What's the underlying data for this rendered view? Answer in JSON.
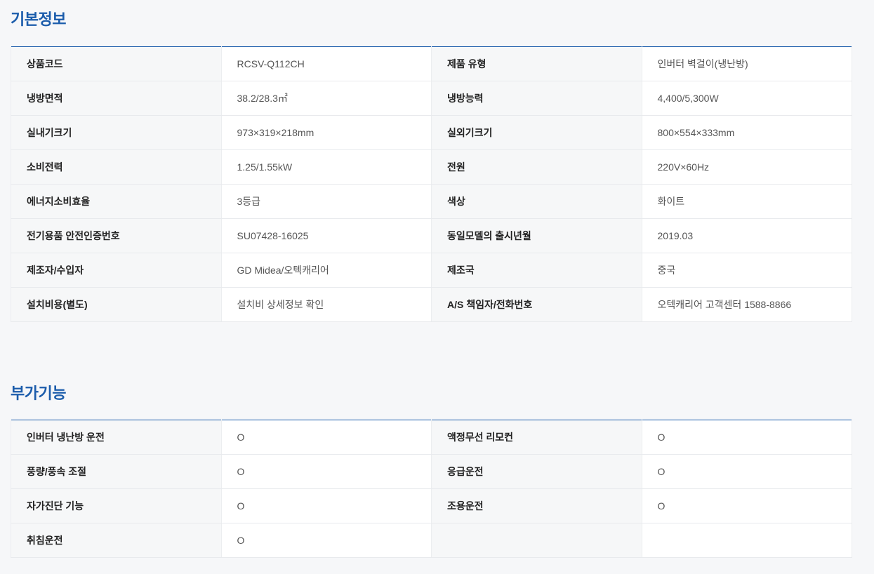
{
  "basic": {
    "title": "기본정보",
    "rows": [
      [
        {
          "label": "상품코드",
          "value": "RCSV-Q112CH"
        },
        {
          "label": "제품 유형",
          "value": "인버터 벽걸이(냉난방)"
        }
      ],
      [
        {
          "label": "냉방면적",
          "value": "38.2/28.3㎡"
        },
        {
          "label": "냉방능력",
          "value": "4,400/5,300W"
        }
      ],
      [
        {
          "label": "실내기크기",
          "value": "973×319×218mm"
        },
        {
          "label": "실외기크기",
          "value": "800×554×333mm"
        }
      ],
      [
        {
          "label": "소비전력",
          "value": "1.25/1.55kW"
        },
        {
          "label": "전원",
          "value": "220V×60Hz"
        }
      ],
      [
        {
          "label": "에너지소비효율",
          "value": "3등급"
        },
        {
          "label": "색상",
          "value": "화이트"
        }
      ],
      [
        {
          "label": "전기용품 안전인증번호",
          "value": "SU07428-16025"
        },
        {
          "label": "동일모델의 출시년월",
          "value": "2019.03"
        }
      ],
      [
        {
          "label": "제조자/수입자",
          "value": "GD Midea/오텍캐리어"
        },
        {
          "label": "제조국",
          "value": "중국"
        }
      ],
      [
        {
          "label": "설치비용(별도)",
          "value": "설치비 상세정보 확인"
        },
        {
          "label": "A/S 책임자/전화번호",
          "value": "오텍캐리어 고객센터 1588-8866"
        }
      ]
    ]
  },
  "extra": {
    "title": "부가기능",
    "rows": [
      [
        {
          "label": "인버터 냉난방 운전",
          "value": "O"
        },
        {
          "label": "액정무선 리모컨",
          "value": "O"
        }
      ],
      [
        {
          "label": "풍량/풍속 조절",
          "value": "O"
        },
        {
          "label": "응급운전",
          "value": "O"
        }
      ],
      [
        {
          "label": "자가진단 기능",
          "value": "O"
        },
        {
          "label": "조용운전",
          "value": "O"
        }
      ],
      [
        {
          "label": "취침운전",
          "value": "O"
        },
        {
          "label": "",
          "value": ""
        }
      ]
    ]
  }
}
